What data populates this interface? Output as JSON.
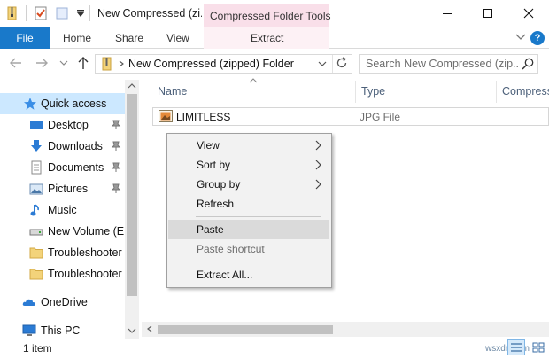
{
  "window": {
    "title": "New Compressed (zi...",
    "contextual_tab_group": "Compressed Folder Tools",
    "minimize_icon": "minimize-icon",
    "maximize_icon": "maximize-icon",
    "close_icon": "close-icon"
  },
  "ribbon": {
    "tabs": [
      {
        "label": "File"
      },
      {
        "label": "Home"
      },
      {
        "label": "Share"
      },
      {
        "label": "View"
      },
      {
        "label": "Extract"
      }
    ],
    "help_label": "?",
    "accent_color": "#1979ca",
    "contextual_color": "#f9dfe9"
  },
  "navigation": {
    "address": "New Compressed (zipped) Folder",
    "search_placeholder": "Search New Compressed (zip..."
  },
  "nav_pane": {
    "items": [
      {
        "label": "Quick access",
        "icon": "star-icon",
        "selected": true
      },
      {
        "label": "Desktop",
        "icon": "desktop-icon",
        "pinned": true
      },
      {
        "label": "Downloads",
        "icon": "download-icon",
        "pinned": true
      },
      {
        "label": "Documents",
        "icon": "document-icon",
        "pinned": true
      },
      {
        "label": "Pictures",
        "icon": "picture-icon",
        "pinned": true
      },
      {
        "label": "Music",
        "icon": "music-icon"
      },
      {
        "label": "New Volume (E:)",
        "icon": "drive-icon"
      },
      {
        "label": "Troubleshooter",
        "icon": "folder-icon"
      },
      {
        "label": "Troubleshooter V",
        "icon": "folder-icon"
      },
      {
        "label": "OneDrive",
        "icon": "cloud-icon"
      },
      {
        "label": "This PC",
        "icon": "computer-icon"
      }
    ]
  },
  "file_list": {
    "columns": [
      "Name",
      "Type",
      "Compress"
    ],
    "rows": [
      {
        "name": "LIMITLESS",
        "type": "JPG File"
      }
    ]
  },
  "context_menu": {
    "items": [
      {
        "label": "View",
        "submenu": true
      },
      {
        "label": "Sort by",
        "submenu": true
      },
      {
        "label": "Group by",
        "submenu": true
      },
      {
        "label": "Refresh"
      },
      {
        "label": "Paste",
        "highlighted": true
      },
      {
        "label": "Paste shortcut",
        "disabled": true
      },
      {
        "label": "Extract All..."
      }
    ]
  },
  "status_bar": {
    "item_count": "1 item"
  },
  "watermark": "wsxdn.com"
}
